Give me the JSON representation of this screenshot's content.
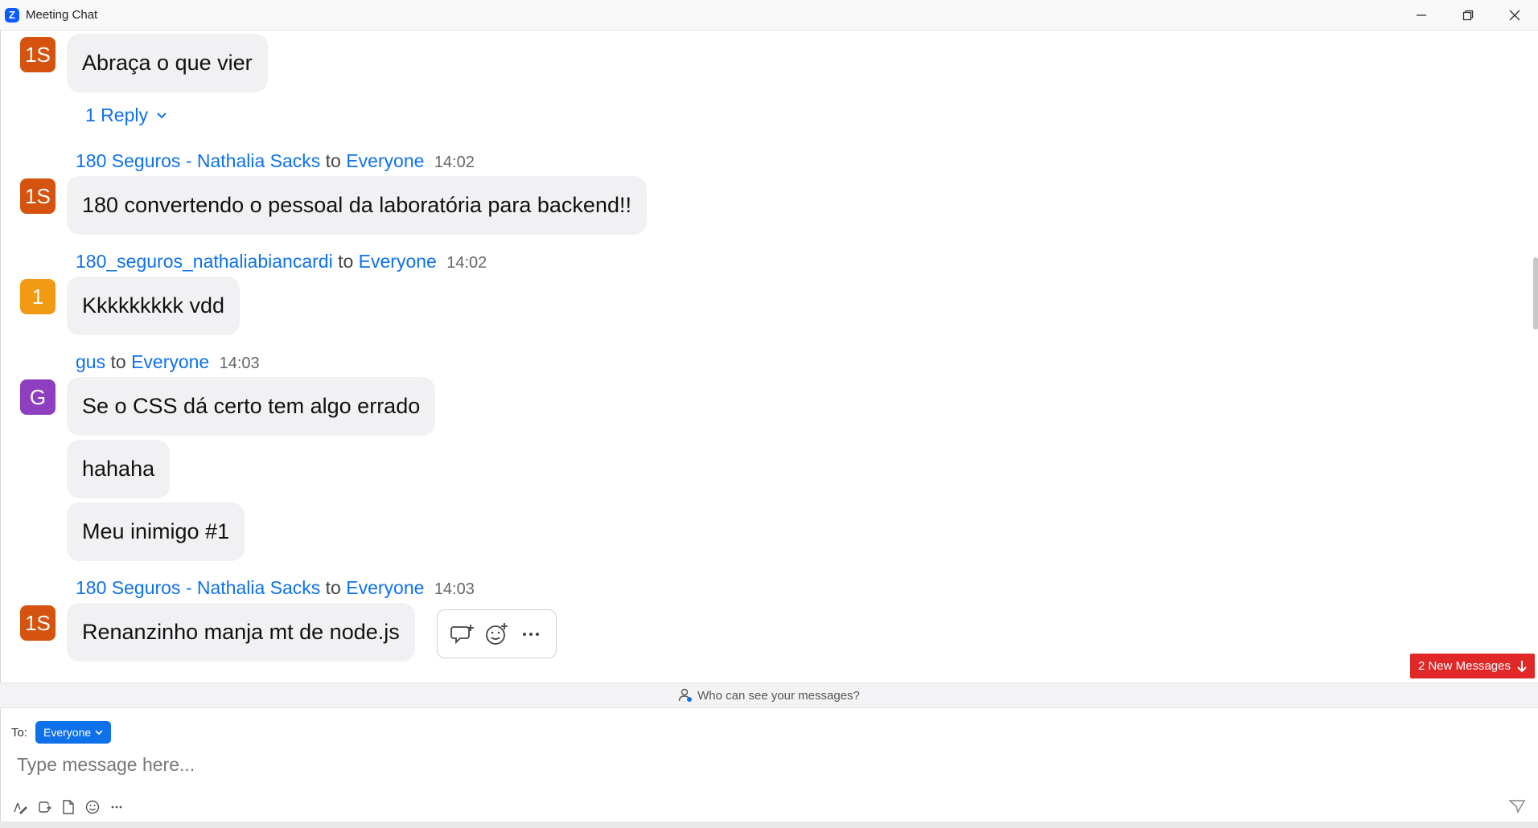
{
  "window": {
    "title": "Meeting Chat",
    "logo_letter": "Z",
    "icons": [
      "app-logo-icon",
      "minimize-icon",
      "restore-icon",
      "close-icon"
    ]
  },
  "colors": {
    "accent": "#0e71eb",
    "avatar_orange": "#d5530f",
    "avatar_amber": "#f29a14",
    "avatar_purple": "#8e3fbf",
    "alert_red": "#e02828",
    "bubble_bg": "#f1f1f4"
  },
  "chat": {
    "first": {
      "avatar": "1S",
      "text": "Abraça o que vier",
      "reply": "1 Reply"
    },
    "messages": [
      {
        "sender": "180 Seguros - Nathalia Sacks",
        "to_word": "to",
        "target": "Everyone",
        "time": "14:02",
        "avatar": "1S",
        "bubbles": [
          "180 convertendo o pessoal da laboratória para backend!!"
        ]
      },
      {
        "sender": "180_seguros_nathaliabiancardi",
        "to_word": "to",
        "target": "Everyone",
        "time": "14:02",
        "avatar": "1",
        "bubbles": [
          "Kkkkkkkkk vdd"
        ]
      },
      {
        "sender": "gus",
        "to_word": "to",
        "target": "Everyone",
        "time": "14:03",
        "avatar": "G",
        "bubbles": [
          "Se o CSS dá certo tem algo errado",
          "hahaha",
          "Meu inimigo #1"
        ]
      },
      {
        "sender": "180 Seguros - Nathalia Sacks",
        "to_word": "to",
        "target": "Everyone",
        "time": "14:03",
        "avatar": "1S",
        "bubbles": [
          "Renanzinho manja mt de node.js"
        ]
      }
    ],
    "hover_toolbar_icons": [
      "reply-in-thread-icon",
      "add-reaction-icon",
      "more-options-icon"
    ],
    "new_messages_label": "2 New Messages"
  },
  "privacy": {
    "label": "Who can see your messages?"
  },
  "composer": {
    "to_label": "To:",
    "recipient": "Everyone",
    "placeholder": "Type message here...",
    "tool_icons": [
      "format-icon",
      "screenshot-icon",
      "file-icon",
      "emoji-icon",
      "more-icon"
    ],
    "send_icon": "send-icon"
  }
}
